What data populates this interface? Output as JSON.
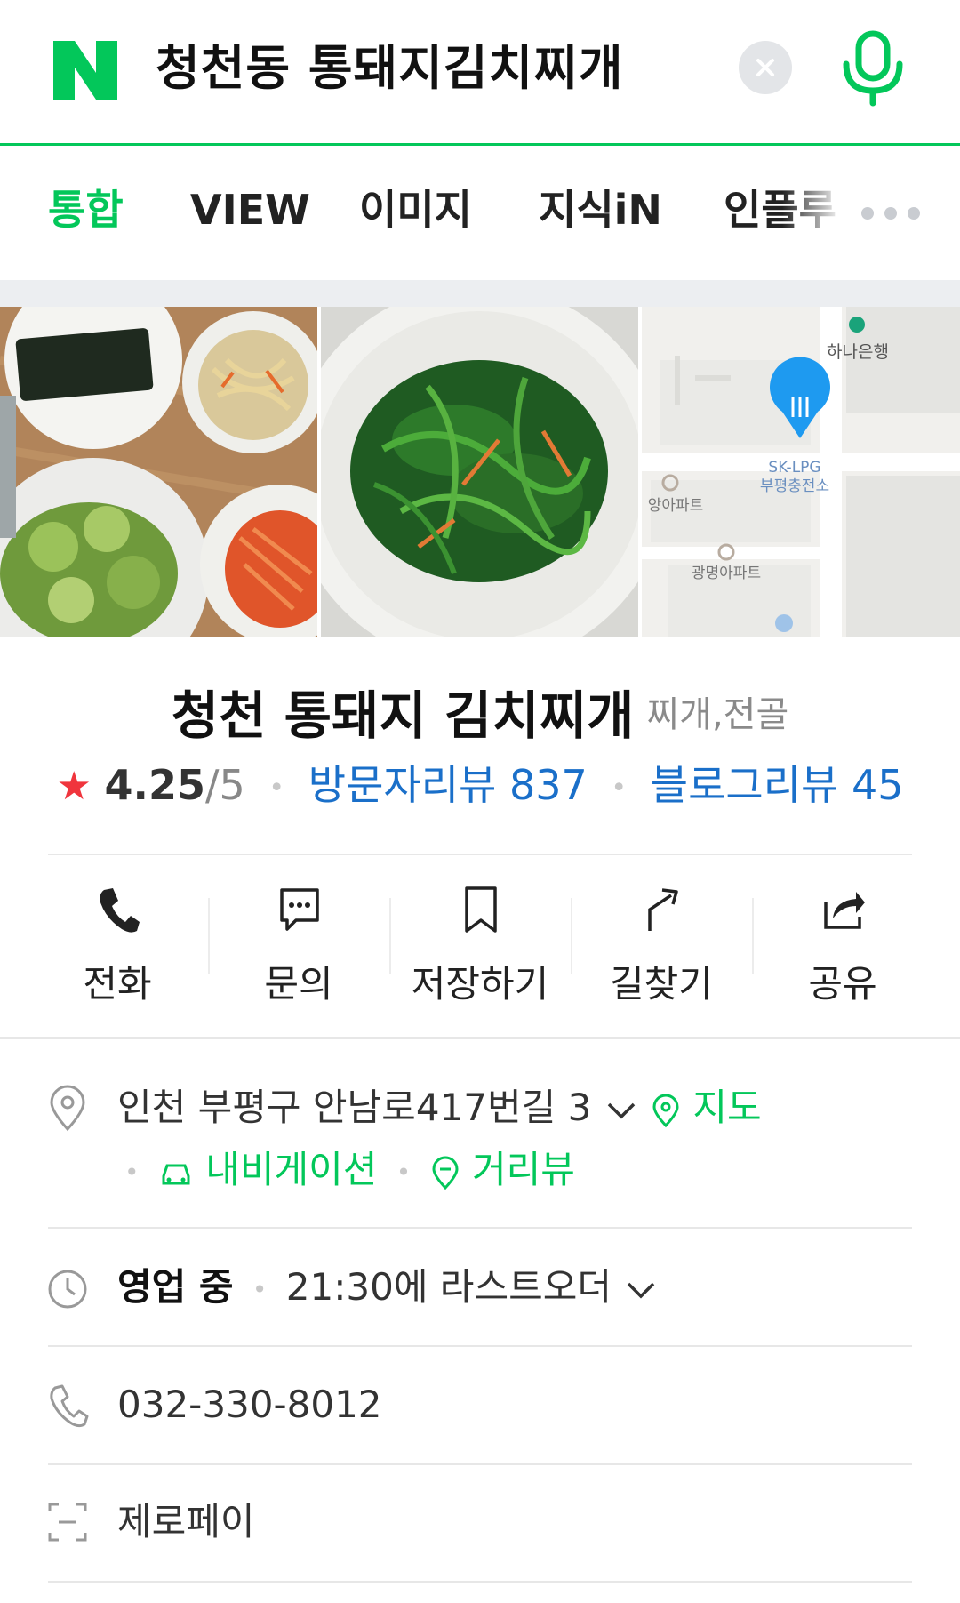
{
  "search": {
    "logo": "N",
    "query": "청천동 통돼지김치찌개"
  },
  "tabs": [
    {
      "label": "통합",
      "active": true
    },
    {
      "label": "VIEW",
      "active": false
    },
    {
      "label": "이미지",
      "active": false
    },
    {
      "label": "지식iN",
      "active": false
    },
    {
      "label": "인플루",
      "active": false
    }
  ],
  "map": {
    "labels": {
      "bank": "하나은행",
      "poi_line1": "SK-LPG",
      "poi_line2": "부평충전소",
      "apt1": "앙아파트",
      "apt2": "광명아파트"
    }
  },
  "place": {
    "name": "청천 통돼지 김치찌개",
    "category": "찌개,전골",
    "rating": "4.25",
    "rating_max": "/5",
    "visitor_reviews_label": "방문자리뷰",
    "visitor_reviews_count": "837",
    "blog_reviews_label": "블로그리뷰",
    "blog_reviews_count": "45"
  },
  "actions": [
    {
      "label": "전화",
      "icon": "phone-icon"
    },
    {
      "label": "문의",
      "icon": "chat-icon"
    },
    {
      "label": "저장하기",
      "icon": "bookmark-icon"
    },
    {
      "label": "길찾기",
      "icon": "directions-icon"
    },
    {
      "label": "공유",
      "icon": "share-icon"
    }
  ],
  "info": {
    "address": "인천 부평구 안남로417번길 3",
    "map_link": "지도",
    "navigation_link": "내비게이션",
    "streetview_link": "거리뷰",
    "hours_status": "영업 중",
    "hours_detail": "21:30에 라스트오더",
    "phone": "032-330-8012",
    "zeropay": "제로페이"
  },
  "colors": {
    "brand_green": "#03c75a",
    "link_blue": "#1a6fc9",
    "star_red": "#f0353d",
    "map_pin_blue": "#1e9af0"
  }
}
